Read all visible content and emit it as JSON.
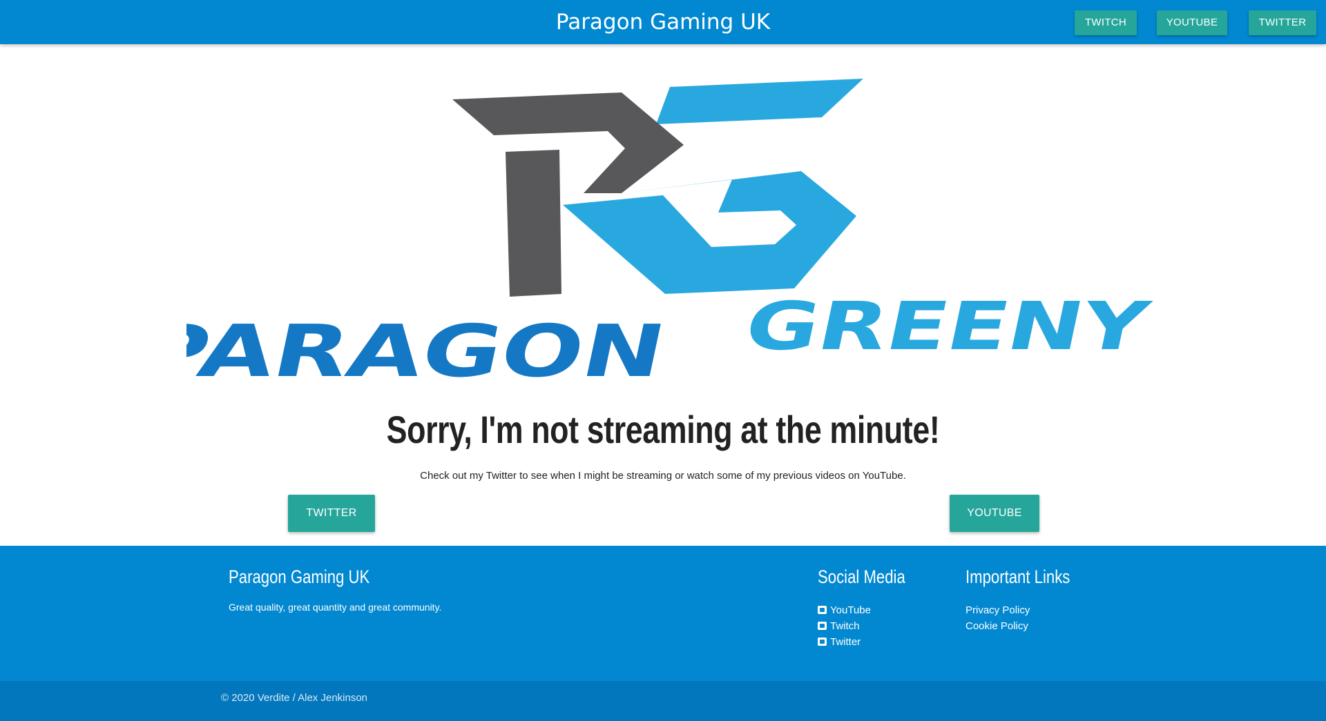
{
  "header": {
    "brand": "Paragon Gaming UK",
    "nav": {
      "twitch": "TWITCH",
      "youtube": "YOUTUBE",
      "twitter": "TWITTER"
    }
  },
  "logo": {
    "monogram": "PG",
    "wordmark_left": "PARAGON",
    "wordmark_right": "GREENY"
  },
  "main": {
    "headline": "Sorry, I'm not streaming at the minute!",
    "subtext": "Check out my Twitter to see when I might be streaming or watch some of my previous videos on YouTube.",
    "twitter_button": "TWITTER",
    "youtube_button": "YOUTUBE"
  },
  "footer": {
    "brand_title": "Paragon Gaming UK",
    "brand_text": "Great quality, great quantity and great community.",
    "social_title": "Social Media",
    "social_links": [
      "YouTube",
      "Twitch",
      "Twitter"
    ],
    "links_title": "Important Links",
    "important_links": [
      "Privacy Policy",
      "Cookie Policy"
    ],
    "copyright": "© 2020 Verdite / Alex Jenkinson"
  },
  "colors": {
    "primary": "#0288d1",
    "accent": "#26a69a",
    "logo_dark": "#58585a",
    "logo_light": "#29a8e0",
    "logo_blue": "#1578c5"
  }
}
